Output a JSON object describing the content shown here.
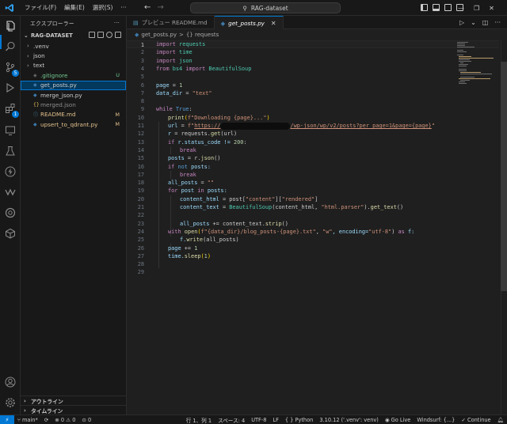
{
  "titlebar": {
    "menus": [
      "ファイル(F)",
      "編集(E)",
      "選択(S)",
      "···"
    ],
    "search_text": "RAG-dataset"
  },
  "sidebar": {
    "title": "エクスプローラー",
    "more": "···",
    "root": "RAG-DATASET",
    "items": [
      {
        "label": ".venv",
        "type": "folder",
        "status": "",
        "color": "#cccccc"
      },
      {
        "label": "json",
        "type": "folder",
        "status": "",
        "color": "#cccccc"
      },
      {
        "label": "text",
        "type": "folder",
        "status": "",
        "color": "#cccccc"
      },
      {
        "label": ".gitignore",
        "type": "git",
        "status": "U",
        "color": "#73c991"
      },
      {
        "label": "get_posts.py",
        "type": "py",
        "status": "",
        "color": "#cccccc"
      },
      {
        "label": "merge_json.py",
        "type": "py",
        "status": "",
        "color": "#cccccc"
      },
      {
        "label": "merged.json",
        "type": "json",
        "status": "",
        "color": "#8c8c8c"
      },
      {
        "label": "README.md",
        "type": "md",
        "status": "M",
        "color": "#e2c08d"
      },
      {
        "label": "upsert_to_qdrant.py",
        "type": "py",
        "status": "M",
        "color": "#e2c08d"
      }
    ],
    "outline": "アウトライン",
    "timeline": "タイムライン"
  },
  "tabs": [
    {
      "label": "プレビュー README.md",
      "active": false
    },
    {
      "label": "get_posts.py",
      "active": true
    }
  ],
  "breadcrumb": {
    "file": "get_posts.py",
    "sep": ">",
    "symbol": "{} requests"
  },
  "editor": {
    "line_numbers": [
      "1",
      "2",
      "3",
      "4",
      "5",
      "6",
      "7",
      "8",
      "9",
      "10",
      "11",
      "12",
      "13",
      "14",
      "15",
      "16",
      "17",
      "18",
      "19",
      "20",
      "21",
      "22",
      "23",
      "24",
      "25",
      "26",
      "27",
      "28",
      "29"
    ],
    "code": {
      "l1": [
        "import",
        " requests"
      ],
      "l2": [
        "import",
        " time"
      ],
      "l3": [
        "import",
        " json"
      ],
      "l4": [
        "from",
        " bs4 ",
        "import",
        " BeautifulSoup"
      ],
      "l6": [
        "page",
        " = ",
        "1"
      ],
      "l7": [
        "data_dir",
        " = ",
        "\"text\""
      ],
      "l9": [
        "while",
        " ",
        "True",
        ":"
      ],
      "l10": [
        "print",
        "(",
        "f\"Downloading {page}...\"",
        ")"
      ],
      "l11": [
        "url",
        " = ",
        "f\"",
        "https://",
        "/wp-json/wp/v2/posts?per_page=1&page={page}",
        "\""
      ],
      "l12": [
        "r",
        " = requests.",
        "get",
        "(url)"
      ],
      "l13": [
        "if",
        " r.status_code != ",
        "200",
        ":"
      ],
      "l14": [
        "break"
      ],
      "l15": [
        "posts",
        " = r.",
        "json",
        "()"
      ],
      "l16": [
        "if",
        " ",
        "not",
        " posts:"
      ],
      "l17": [
        "break"
      ],
      "l18": [
        "all_posts",
        " = ",
        "\"\""
      ],
      "l19": [
        "for",
        " post ",
        "in",
        " posts:"
      ],
      "l20": [
        "content_html",
        " = post[",
        "\"content\"",
        "][",
        "\"rendered\"",
        "]"
      ],
      "l21": [
        "content_text",
        " = ",
        "BeautifulSoup",
        "(content_html, ",
        "\"html.parser\"",
        ").",
        "get_text",
        "()"
      ],
      "l23": [
        "all_posts",
        " += content_text.",
        "strip",
        "()"
      ],
      "l24": [
        "with",
        " ",
        "open",
        "(",
        "f\"{data_dir}/blog_posts-{page}.txt\"",
        ", ",
        "\"w\"",
        ", encoding=",
        "\"utf-8\"",
        ") ",
        "as",
        " f:"
      ],
      "l25": [
        "f.",
        "write",
        "(all_posts)"
      ],
      "l26": [
        "page",
        " += ",
        "1"
      ],
      "l27": [
        "time.",
        "sleep",
        "(",
        "1",
        ")"
      ]
    }
  },
  "statusbar": {
    "branch": "main*",
    "sync": "⟳",
    "problems": "⊗ 0 ⚠ 0",
    "ports": "0",
    "position": "行 1、列 1",
    "spaces": "スペース: 4",
    "encoding": "UTF-8",
    "eol": "LF",
    "language": "{ } Python",
    "interpreter": "3.10.12 ('.venv': venv)",
    "golive": "Go Live",
    "windsurf": "Windsurf: {...}",
    "continue": "✓ Continue"
  },
  "colors": {
    "accent": "#0078d4",
    "untracked": "#73c991",
    "modified": "#e2c08d"
  }
}
